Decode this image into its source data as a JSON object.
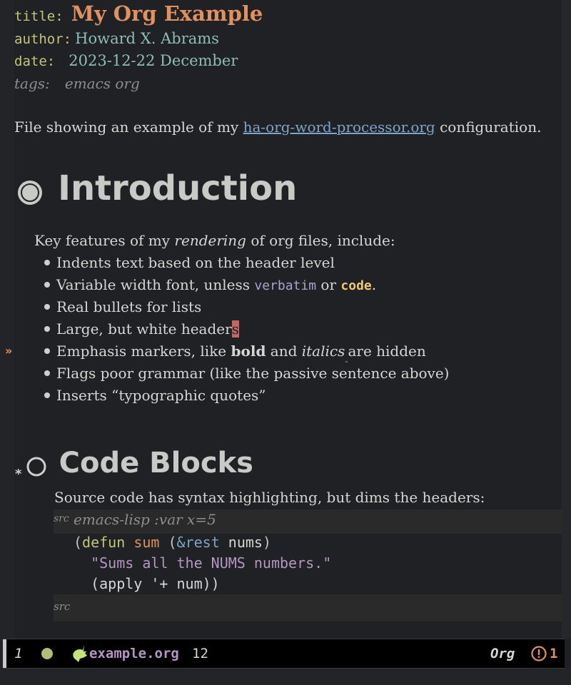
{
  "header": {
    "title_key": "title:",
    "title_value": "My Org Example",
    "author_key": "author:",
    "author_value": "Howard X. Abrams",
    "date_key": "date:",
    "date_value": "2023-12-22 December",
    "tags_key": "tags:",
    "tags_value": "emacs org"
  },
  "intro_paragraph": {
    "before": "File showing an example of my ",
    "link": "ha-org-word-processor.org",
    "after": " configuration."
  },
  "section1": {
    "bullet_icon": "circle-filled-ring-icon",
    "heading": "Introduction",
    "lead_before": "Key features of my ",
    "lead_italic": "rendering",
    "lead_after": " of org files, include:",
    "items": [
      {
        "text": "Indents text based on the header level"
      },
      {
        "before": "Variable width font, unless ",
        "verbatim": "verbatim",
        "mid": " or ",
        "code": "code",
        "after": "."
      },
      {
        "text": "Real bullets for lists"
      },
      {
        "before": "Large, but white header",
        "cursor_char": "s"
      },
      {
        "before": "Emphasis markers, like ",
        "bold": "bold",
        "mid": " and ",
        "italic": "italics",
        "squiggle": "‸",
        "after": "are hidden"
      },
      {
        "text": "Flags poor grammar (like the passive sentence above)"
      },
      {
        "text": "Inserts “typographic quotes”"
      }
    ],
    "fringe_marker": "»"
  },
  "section2": {
    "star": "*",
    "bullet_icon": "circle-outline-icon",
    "heading": "Code Blocks",
    "lead": "Source code has syntax highlighting, but dims the headers:",
    "src_begin_label": "src",
    "src_begin_args": "emacs-lisp :var x=5",
    "code_lines": [
      [
        {
          "t": "(",
          "c": "paren"
        },
        {
          "t": "defun",
          "c": "def"
        },
        {
          "t": " "
        },
        {
          "t": "sum",
          "c": "fn"
        },
        {
          "t": " ("
        },
        {
          "t": "&rest",
          "c": "rest"
        },
        {
          "t": " nums",
          "c": "plain"
        },
        {
          "t": ")",
          "c": "paren"
        }
      ],
      [
        {
          "t": "  "
        },
        {
          "t": "\"Sums all the NUMS numbers.\"",
          "c": "str"
        }
      ],
      [
        {
          "t": "  "
        },
        {
          "t": "(apply '+ num))",
          "c": "plain"
        }
      ]
    ],
    "src_end_label": "src"
  },
  "modeline": {
    "window_number": "1",
    "status_dot_color": "#b5bb74",
    "mode_icon": "unicorn-icon",
    "filename": "example.org",
    "line_number": "12",
    "major_mode": "Org",
    "warning_icon": "warning-circle-icon",
    "warning_count": "1"
  },
  "colors": {
    "background": "#202124",
    "title": "#e0915f",
    "keyword": "#c2c57a",
    "meta_value": "#8fbcb6",
    "link": "#7fa3c8",
    "verbatim": "#a9a3d0",
    "code": "#f0c674",
    "cursor": "#c86464",
    "filename": "#b596c2"
  }
}
